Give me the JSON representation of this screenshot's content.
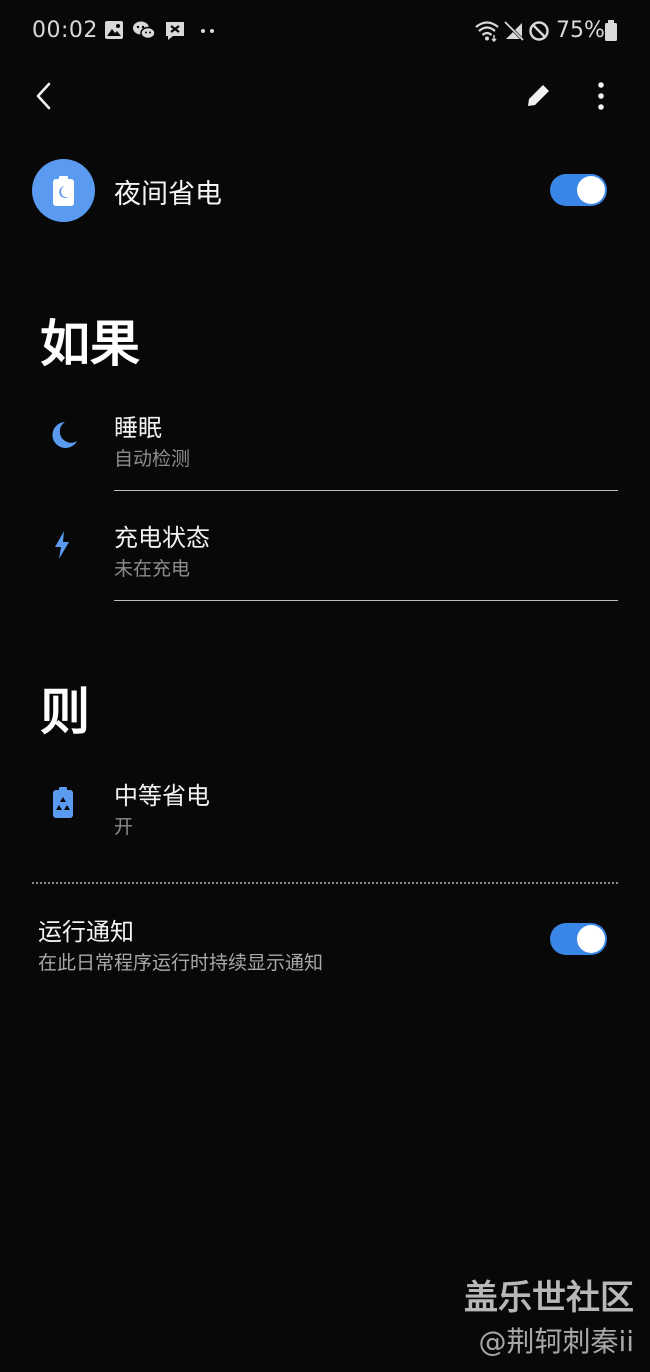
{
  "status_bar": {
    "time": "00:02",
    "battery_percent": "75%",
    "left_icons": [
      "gallery-icon",
      "wechat-icon",
      "app-notification-icon",
      "more-notifications-icon"
    ],
    "right_icons": [
      "wifi-icon",
      "mobile-data-off-icon",
      "do-not-disturb-icon",
      "battery-icon"
    ]
  },
  "toolbar": {
    "back_icon": "back-arrow-icon",
    "edit_icon": "pencil-icon",
    "more_icon": "more-vertical-icon"
  },
  "routine": {
    "title": "夜间省电",
    "icon": "battery-moon-icon",
    "enabled": true
  },
  "if_section": {
    "heading": "如果",
    "conditions": [
      {
        "title": "睡眠",
        "subtitle": "自动检测",
        "icon": "moon-icon"
      },
      {
        "title": "充电状态",
        "subtitle": "未在充电",
        "icon": "lightning-icon"
      }
    ]
  },
  "then_section": {
    "heading": "则",
    "actions": [
      {
        "title": "中等省电",
        "subtitle": "开",
        "icon": "battery-recycle-icon"
      }
    ]
  },
  "notification": {
    "title": "运行通知",
    "subtitle": "在此日常程序运行时持续显示通知",
    "enabled": true
  },
  "watermark": {
    "line1": "盖乐世社区",
    "line2": "@荆轲刺秦ii"
  },
  "colors": {
    "background": "#080808",
    "accent": "#3a86e6",
    "icon_blue": "#5a9af0"
  }
}
